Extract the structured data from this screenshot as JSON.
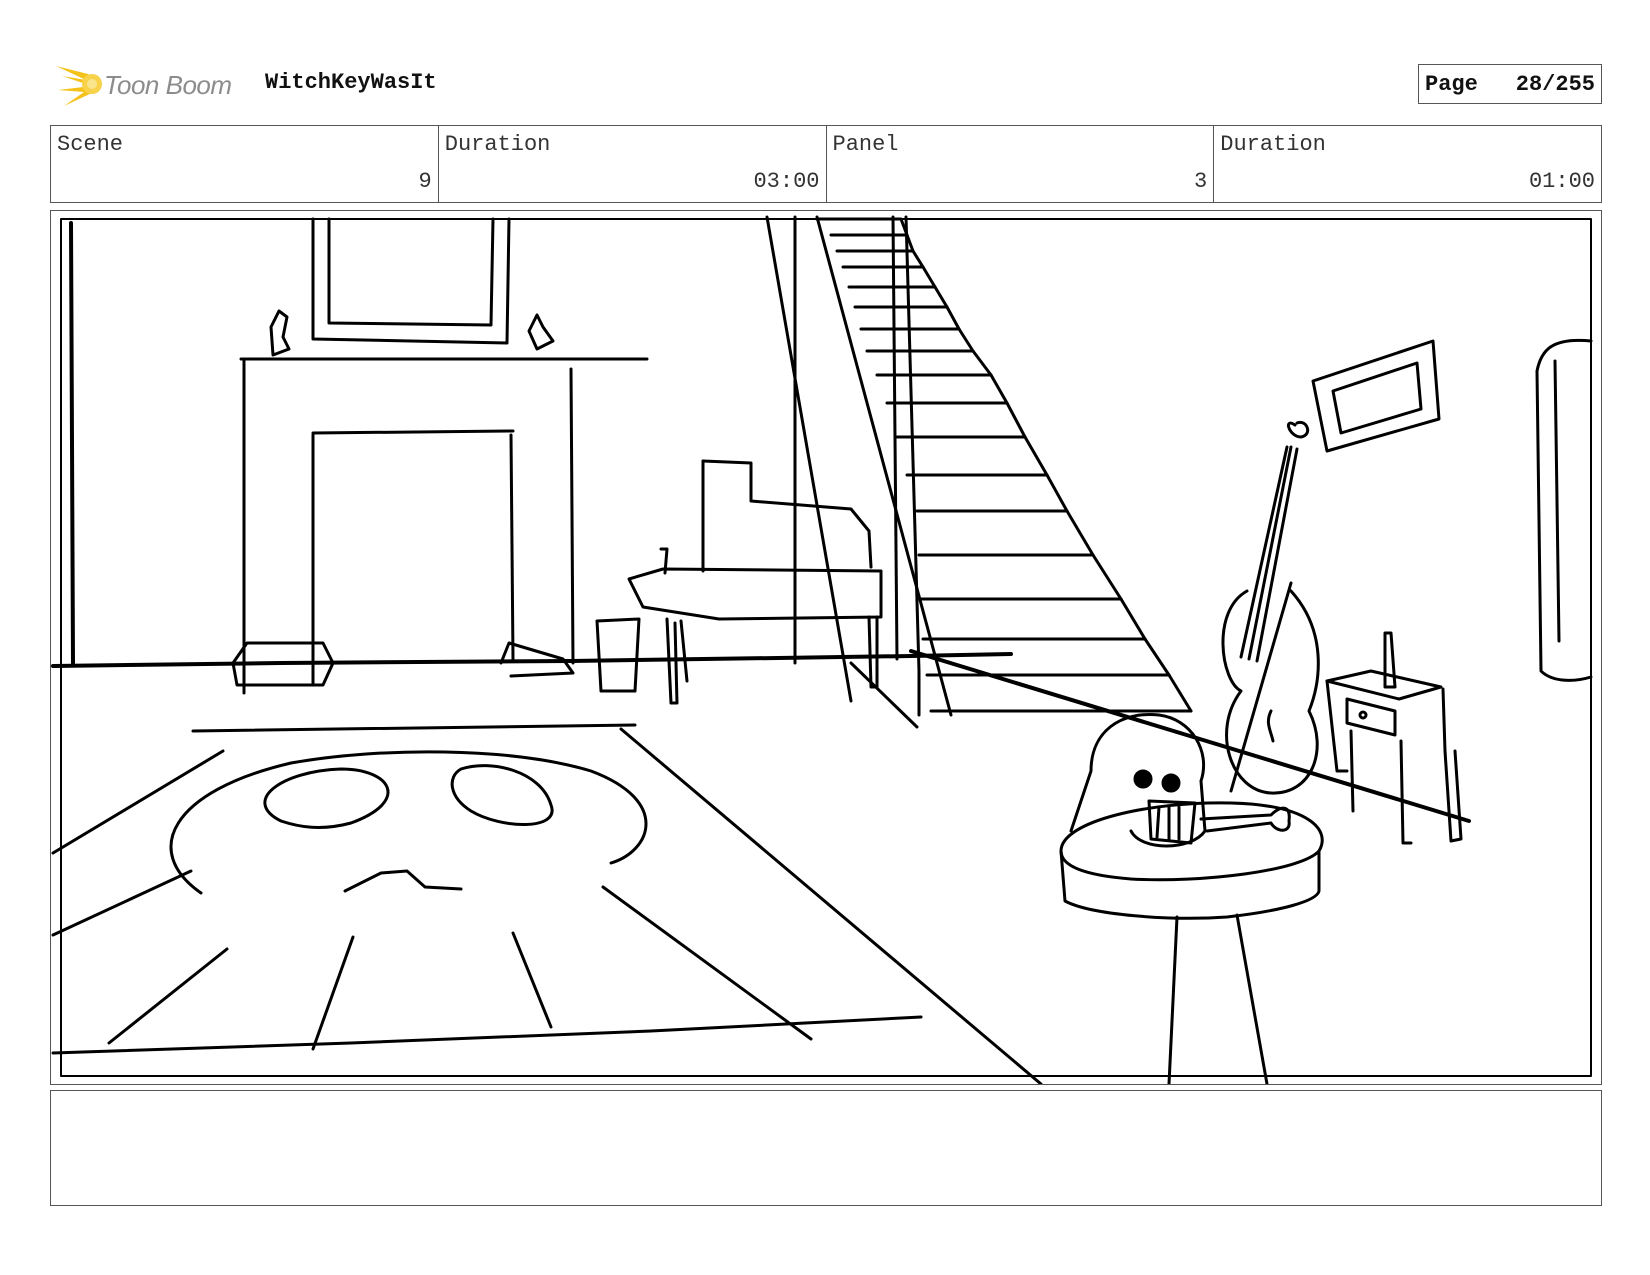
{
  "header": {
    "logo_text": "Toon Boom",
    "project_name": "WitchKeyWasIt",
    "page_label": "Page",
    "page_value": "28/255"
  },
  "info": {
    "scene_label": "Scene",
    "scene_value": "9",
    "scene_duration_label": "Duration",
    "scene_duration_value": "03:00",
    "panel_label": "Panel",
    "panel_value": "3",
    "panel_duration_label": "Duration",
    "panel_duration_value": "01:00"
  },
  "notes": {
    "text": ""
  },
  "colors": {
    "logo_accent": "#f5c21a",
    "logo_text": "#8c8c8c",
    "border": "#555555",
    "sketch": "#000000"
  }
}
